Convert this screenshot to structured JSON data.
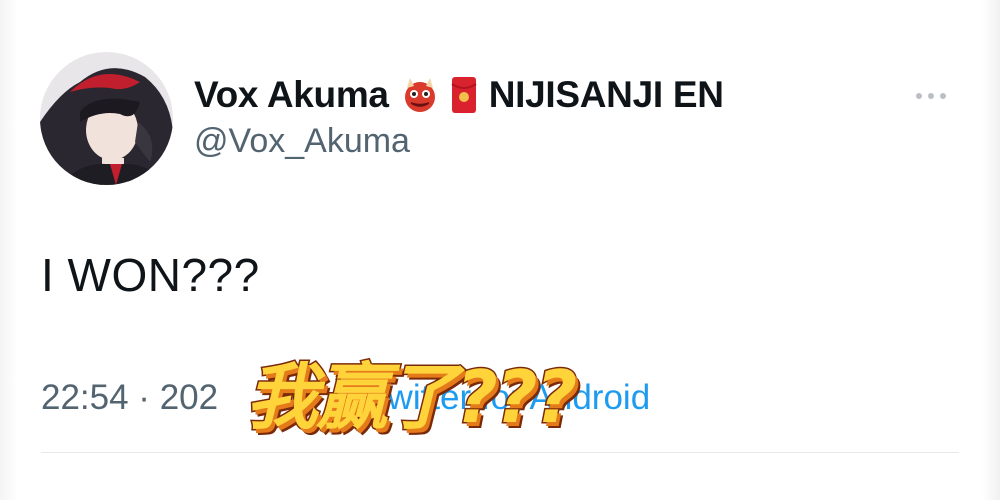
{
  "tweet": {
    "display_name": "Vox Akuma",
    "emojis": [
      "ogre-emoji",
      "red-envelope-emoji"
    ],
    "affiliation": "NIJISANJI EN",
    "handle": "@Vox_Akuma",
    "text": "I WON???",
    "time": "22:54 · 202",
    "source": "Twitter for Android"
  },
  "overlay": {
    "caption": "我赢了???"
  },
  "colors": {
    "text": "#0f1419",
    "secondary": "#536471",
    "link": "#1d9bf0",
    "overlay_fill": "#ffd43b",
    "overlay_outline": "#7a2a0a"
  }
}
